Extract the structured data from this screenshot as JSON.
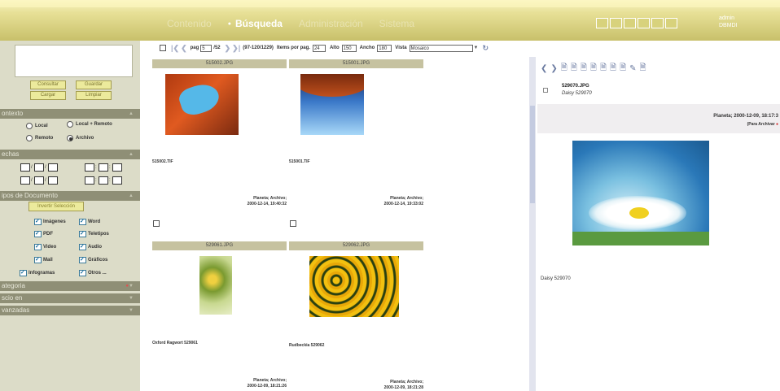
{
  "nav": {
    "items": [
      "Contenido",
      "Búsqueda",
      "Administración",
      "Sistema"
    ],
    "active_index": 1
  },
  "user": {
    "name": "admin",
    "code": "DBMDI"
  },
  "left": {
    "buttons": {
      "consultar": "Consultar",
      "guardar": "Guardar",
      "cargar": "Cargar",
      "limpiar": "Limpiar"
    },
    "sections": {
      "contexto": "ontexto",
      "fechas": "echas",
      "tipos": "ipos de Documento",
      "categoria": "ategoria",
      "buscar_en": "scio en",
      "avanzadas": "vanzadas"
    },
    "radios": {
      "local": "Local",
      "local_remoto": "Local + Remoto",
      "remoto": "Remoto",
      "archivo": "Archivo"
    },
    "invert_label": "Invertir Selección",
    "types": [
      "Imágenes",
      "Word",
      "PDF",
      "Teletipos",
      "Video",
      "Audio",
      "Mail",
      "Gráficos",
      "Infogramas",
      "Otros ..."
    ]
  },
  "toolbar": {
    "pag_label": "pag",
    "page_current": "5",
    "page_total": "/52",
    "range": "(97-120/1229)",
    "items_label": "Items por pag.",
    "items_value": "24",
    "alto_label": "Alto",
    "alto_value": "150",
    "ancho_label": "Ancho",
    "ancho_value": "180",
    "vista_label": "Vista",
    "vista_value": "Mosaico"
  },
  "cards": [
    {
      "caption": "515002.JPG",
      "file": "515002.TIF",
      "meta_line1": "Planeta; Archivo;",
      "meta_line2": "2000-12-14, 19:40:32"
    },
    {
      "caption": "515001.JPG",
      "file": "515001.TIF",
      "meta_line1": "Planeta; Archivo;",
      "meta_line2": "2000-12-14, 19:33:02"
    },
    {
      "caption": "529061.JPG",
      "file": "Oxford Ragwort 529061",
      "meta_line1": "Planeta; Archivo;",
      "meta_line2": "2000-12-09, 18:21:26"
    },
    {
      "caption": "529062.JPG",
      "file": "Rudbeckia 529062",
      "meta_line1": "Planeta; Archivo;",
      "meta_line2": "2000-12-09, 18:21:28"
    }
  ],
  "detail": {
    "title": "529070.JPG",
    "subtitle": "Daisy 529070",
    "meta_line1": "Planeta; 2000-12-09, 18:17:3",
    "meta_line2": "(Para Archivar",
    "caption": "Daisy 529070"
  },
  "colors": {
    "bar": "#d9d38a",
    "panel": "#dcdcc8",
    "section_header": "#8f8f76",
    "caption_bg": "#c6c2a0"
  }
}
